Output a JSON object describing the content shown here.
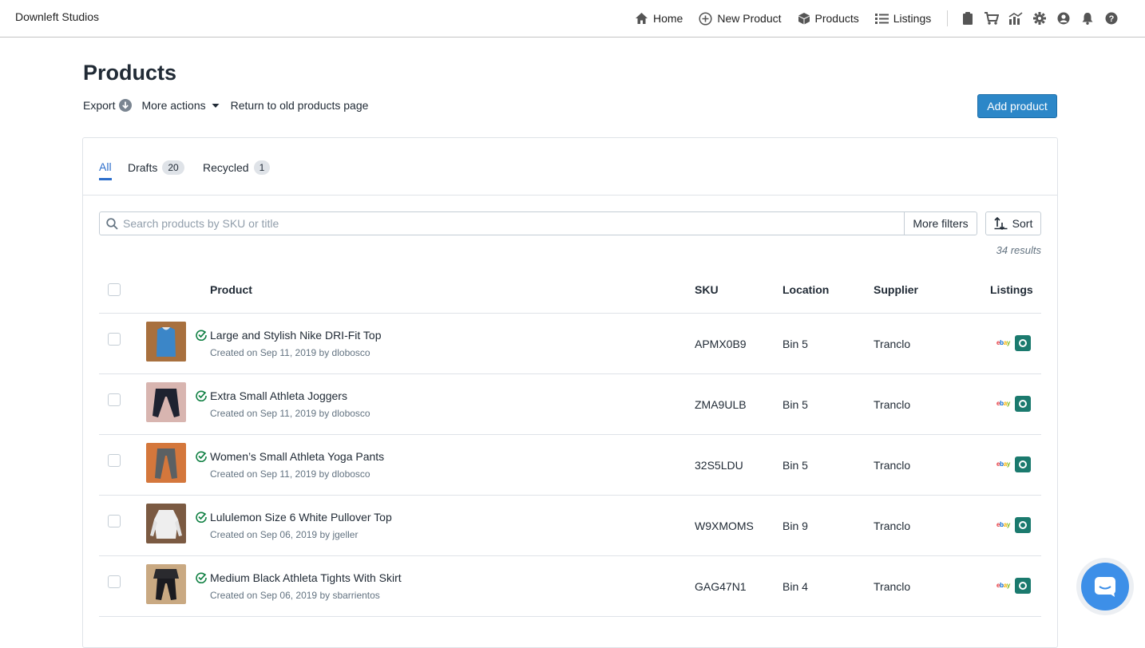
{
  "brand": "Downleft Studios",
  "nav": {
    "home": "Home",
    "new_product": "New Product",
    "products": "Products",
    "listings": "Listings",
    "icons": [
      "clipboard-icon",
      "cart-icon",
      "chart-icon",
      "gear-icon",
      "user-icon",
      "bell-icon",
      "help-icon"
    ]
  },
  "page": {
    "title": "Products",
    "export": "Export",
    "more_actions": "More actions",
    "return_old": "Return to old products page",
    "add_product": "Add product"
  },
  "tabs": [
    {
      "label": "All",
      "count": null
    },
    {
      "label": "Drafts",
      "count": "20"
    },
    {
      "label": "Recycled",
      "count": "1"
    }
  ],
  "search": {
    "placeholder": "Search products by SKU or title",
    "value": ""
  },
  "filters_label": "More filters",
  "sort_label": "Sort",
  "results_text": "34 results",
  "columns": {
    "product": "Product",
    "sku": "SKU",
    "location": "Location",
    "supplier": "Supplier",
    "listings": "Listings"
  },
  "rows": [
    {
      "title": "Large and Stylish Nike DRI-Fit Top",
      "meta": "Created on Sep 11, 2019 by dlobosco",
      "sku": "APMX0B9",
      "location": "Bin 5",
      "supplier": "Tranclo"
    },
    {
      "title": "Extra Small Athleta Joggers",
      "meta": "Created on Sep 11, 2019 by dlobosco",
      "sku": "ZMA9ULB",
      "location": "Bin 5",
      "supplier": "Tranclo"
    },
    {
      "title": "Women’s Small Athleta Yoga Pants",
      "meta": "Created on Sep 11, 2019 by dlobosco",
      "sku": "32S5LDU",
      "location": "Bin 5",
      "supplier": "Tranclo"
    },
    {
      "title": "Lululemon Size 6 White Pullover Top",
      "meta": "Created on Sep 06, 2019 by jgeller",
      "sku": "W9XMOMS",
      "location": "Bin 9",
      "supplier": "Tranclo"
    },
    {
      "title": "Medium Black Athleta Tights With Skirt",
      "meta": "Created on Sep 06, 2019 by sbarrientos",
      "sku": "GAG47N1",
      "location": "Bin 4",
      "supplier": "Tranclo"
    }
  ],
  "colors": {
    "primary": "#2c87c8",
    "tab_active": "#2c6ecb",
    "status_green": "#108043",
    "mercari": "#1b7a6e",
    "chat": "#3d8fe8"
  }
}
